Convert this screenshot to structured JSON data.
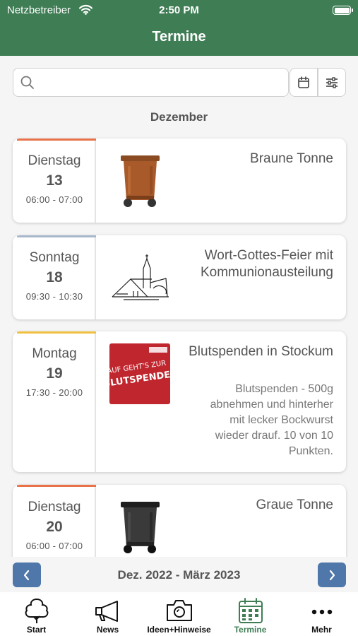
{
  "status_bar": {
    "carrier": "Netzbetreiber",
    "time": "2:50 PM"
  },
  "nav": {
    "title": "Termine"
  },
  "search": {
    "placeholder": "",
    "value": ""
  },
  "month_header": "Dezember",
  "events": [
    {
      "weekday": "Dienstag",
      "day": "13",
      "time": "06:00 - 07:00",
      "title": "Braune Tonne",
      "description": "",
      "accent_color": "#e8734a",
      "thumbnail": "brown-bin-image"
    },
    {
      "weekday": "Sonntag",
      "day": "18",
      "time": "09:30 - 10:30",
      "title": "Wort-Gottes-Feier mit Kommunionausteilung",
      "description": "",
      "accent_color": "#a8b8cc",
      "thumbnail": "church-sketch-image"
    },
    {
      "weekday": "Montag",
      "day": "19",
      "time": "17:30 - 20:00",
      "title": "Blutspenden in Stockum",
      "description": "Blutspenden - 500g abnehmen und hinterher mit lecker Bockwurst wieder drauf. 10 von 10 Punkten.",
      "accent_color": "#f0c040",
      "thumbnail": "blood-donation-poster-image",
      "poster_text": "AUF GEHT'S ZUR BLUTSPENDE!"
    },
    {
      "weekday": "Dienstag",
      "day": "20",
      "time": "06:00 - 07:00",
      "title": "Graue Tonne",
      "description": "",
      "accent_color": "#e8734a",
      "thumbnail": "grey-bin-image"
    }
  ],
  "pager": {
    "label": "Dez. 2022 - März 2023"
  },
  "tabs": [
    {
      "label": "Start",
      "icon": "tree-icon"
    },
    {
      "label": "News",
      "icon": "megaphone-icon"
    },
    {
      "label": "Ideen+Hinweise",
      "icon": "camera-icon"
    },
    {
      "label": "Termine",
      "icon": "calendar-icon"
    },
    {
      "label": "Mehr",
      "icon": "more-icon"
    }
  ],
  "colors": {
    "brand_green": "#3f7d55",
    "pager_blue": "#4f77a9"
  }
}
